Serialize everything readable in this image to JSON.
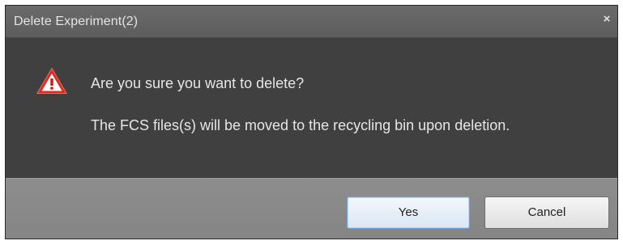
{
  "dialog": {
    "title": "Delete Experiment(2)",
    "close_label": "×",
    "icon": "warning-triangle-icon",
    "message_line1": "Are you sure you want to delete?",
    "message_line2": "The FCS files(s) will be moved to the recycling bin upon deletion.",
    "buttons": {
      "yes_label": "Yes",
      "cancel_label": "Cancel"
    }
  },
  "colors": {
    "warning_red": "#e0281e",
    "title_bar": "#636363",
    "body": "#404040",
    "footer": "#898989",
    "default_button_border": "#6fa3d6"
  }
}
